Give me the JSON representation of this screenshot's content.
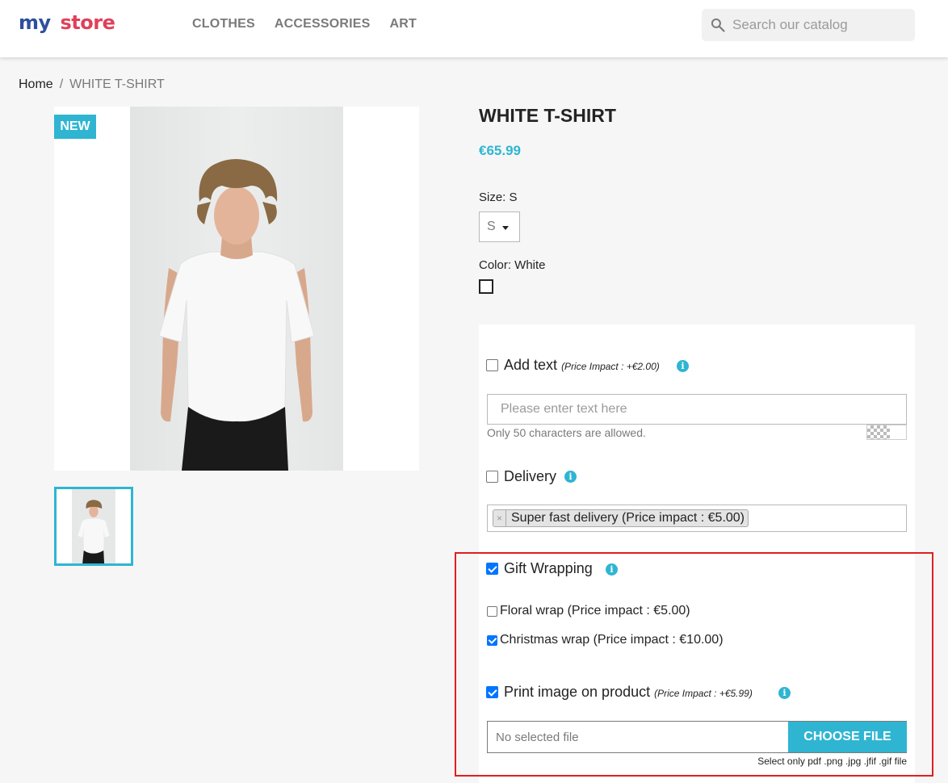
{
  "header": {
    "logo_part1": "my",
    "logo_part2": "store",
    "nav": [
      "CLOTHES",
      "ACCESSORIES",
      "ART"
    ],
    "search_placeholder": "Search our catalog",
    "search_icon": "search-icon"
  },
  "breadcrumb": {
    "home": "Home",
    "separator": "/",
    "current": "WHITE T-SHIRT"
  },
  "product": {
    "badge": "NEW",
    "title": "WHITE T-SHIRT",
    "price": "€65.99",
    "size_label": "Size: S",
    "size_value": "S",
    "color_label": "Color: White",
    "color_swatch": "#ffffff"
  },
  "customization": {
    "add_text": {
      "label": "Add text",
      "impact": "(Price Impact : +€2.00)",
      "checked": false,
      "placeholder": "Please enter text here",
      "hint": "Only 50 characters are allowed."
    },
    "delivery": {
      "label": "Delivery",
      "checked": false,
      "tag_remove": "×",
      "tag": "Super fast delivery (Price impact : €5.00)"
    },
    "gift_wrapping": {
      "label": "Gift Wrapping",
      "checked": true,
      "options": [
        {
          "label": "Floral wrap (Price impact : €5.00)",
          "checked": false
        },
        {
          "label": "Christmas wrap (Price impact : €10.00)",
          "checked": true
        }
      ]
    },
    "print_image": {
      "label": "Print image on product",
      "impact": "(Price Impact : +€5.99)",
      "checked": true,
      "file_placeholder": "No selected file",
      "button": "CHOOSE FILE",
      "hint": "Select only pdf .png .jpg .jfif .gif file"
    },
    "info_glyph": "i"
  },
  "colors": {
    "accent": "#2fb5d2",
    "highlight": "#e01f1f",
    "checkbox": "#0075ff"
  }
}
